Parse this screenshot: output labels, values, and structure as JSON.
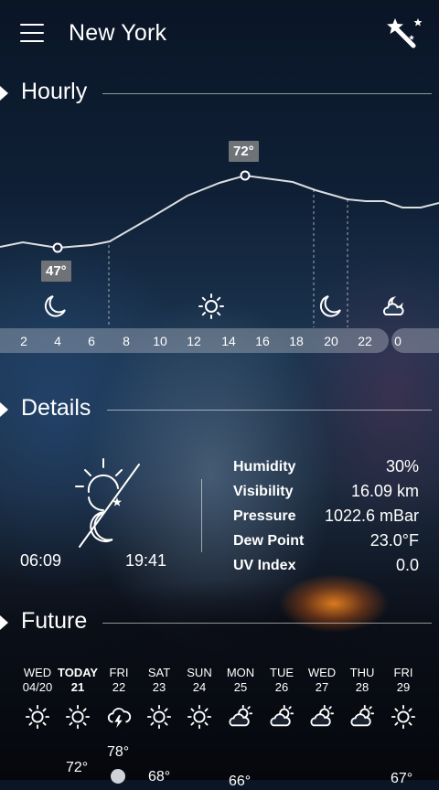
{
  "header": {
    "city": "New York"
  },
  "sections": {
    "hourly": "Hourly",
    "details": "Details",
    "future": "Future"
  },
  "hourly": {
    "max_temp": "72°",
    "min_temp": "47°",
    "hours": [
      "2",
      "4",
      "6",
      "8",
      "10",
      "12",
      "14",
      "16",
      "18",
      "20",
      "22",
      "0"
    ],
    "icons": [
      "moon-icon",
      "sun-icon",
      "moon-icon",
      "partly-cloudy-night-icon"
    ]
  },
  "details": {
    "sunrise": "06:09",
    "sunset": "19:41",
    "rows": [
      {
        "label": "Humidity",
        "value": "30%"
      },
      {
        "label": "Visibility",
        "value": "16.09 km"
      },
      {
        "label": "Pressure",
        "value": "1022.6 mBar"
      },
      {
        "label": "Dew Point",
        "value": "23.0°F"
      },
      {
        "label": "UV Index",
        "value": "0.0"
      }
    ]
  },
  "future": {
    "days": [
      {
        "day": "WED",
        "date": "04/20",
        "icon": "sun-icon"
      },
      {
        "day": "TODAY",
        "date": "21",
        "icon": "sun-icon"
      },
      {
        "day": "FRI",
        "date": "22",
        "icon": "thunder-cloud-icon"
      },
      {
        "day": "SAT",
        "date": "23",
        "icon": "sun-icon"
      },
      {
        "day": "SUN",
        "date": "24",
        "icon": "sun-icon"
      },
      {
        "day": "MON",
        "date": "25",
        "icon": "partly-cloudy-icon"
      },
      {
        "day": "TUE",
        "date": "26",
        "icon": "partly-cloudy-icon"
      },
      {
        "day": "WED",
        "date": "27",
        "icon": "partly-cloudy-icon"
      },
      {
        "day": "THU",
        "date": "28",
        "icon": "partly-cloudy-icon"
      },
      {
        "day": "FRI",
        "date": "29",
        "icon": "sun-icon"
      }
    ],
    "visible_temps": [
      "72°",
      "78°",
      "68°",
      "66°",
      "67°"
    ]
  }
}
